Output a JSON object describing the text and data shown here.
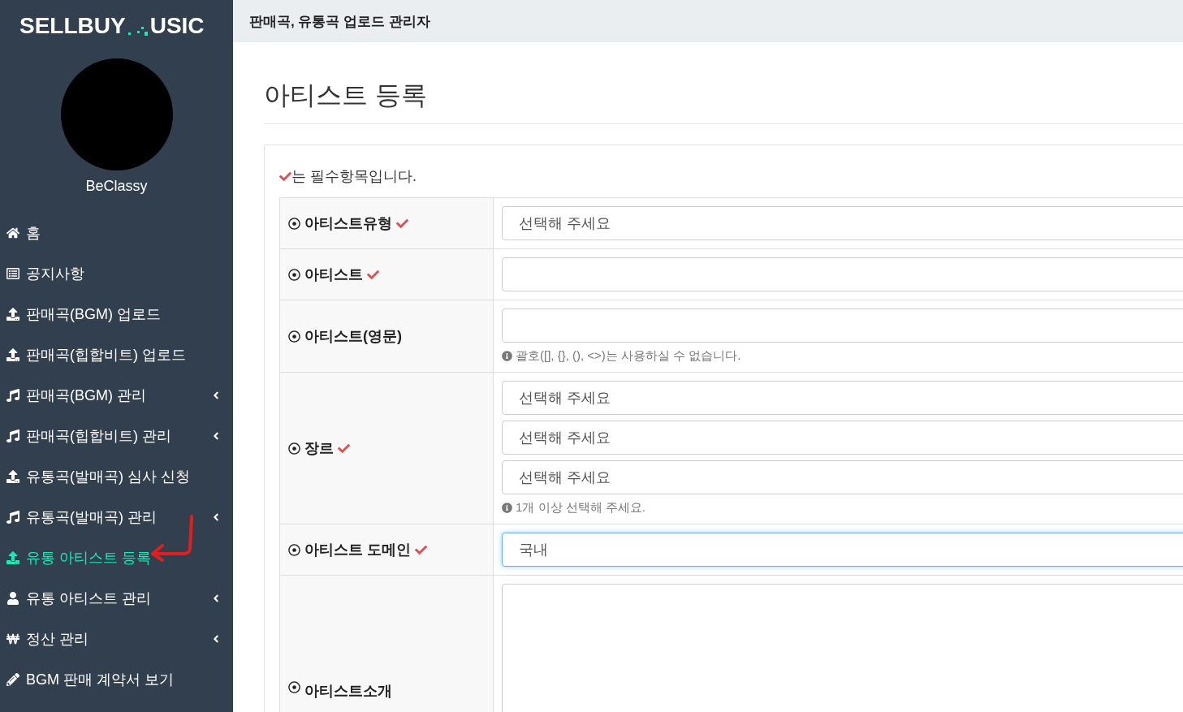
{
  "logo": {
    "left": "SELLBUY",
    "right": "USIC"
  },
  "user": {
    "name": "BeClassy"
  },
  "menu": [
    {
      "label": "홈",
      "submenu": false,
      "selected": false
    },
    {
      "label": "공지사항",
      "submenu": false,
      "selected": false
    },
    {
      "label": "판매곡(BGM) 업로드",
      "submenu": false,
      "selected": false
    },
    {
      "label": "판매곡(힙합비트) 업로드",
      "submenu": false,
      "selected": false
    },
    {
      "label": "판매곡(BGM) 관리",
      "submenu": true,
      "selected": false
    },
    {
      "label": "판매곡(힙합비트) 관리",
      "submenu": true,
      "selected": false
    },
    {
      "label": "유통곡(발매곡) 심사 신청",
      "submenu": false,
      "selected": false
    },
    {
      "label": "유통곡(발매곡) 관리",
      "submenu": true,
      "selected": false
    },
    {
      "label": "유통 아티스트 등록",
      "submenu": false,
      "selected": true
    },
    {
      "label": "유통 아티스트 관리",
      "submenu": true,
      "selected": false
    },
    {
      "label": "정산 관리",
      "submenu": true,
      "selected": false
    },
    {
      "label": "BGM 판매 계약서 보기",
      "submenu": false,
      "selected": false
    }
  ],
  "header": {
    "title": "판매곡, 유통곡 업로드 관리자"
  },
  "page": {
    "title": "아티스트 등록"
  },
  "required_note": "는 필수항목입니다.",
  "form": [
    {
      "label": "아티스트유형",
      "required": true,
      "fields": [
        {
          "kind": "select",
          "value": "선택해 주세요",
          "focused": false
        }
      ]
    },
    {
      "label": "아티스트",
      "required": true,
      "fields": [
        {
          "kind": "input",
          "focused": false
        }
      ]
    },
    {
      "label": "아티스트(영문)",
      "required": false,
      "fields": [
        {
          "kind": "input",
          "focused": false
        }
      ],
      "help": "괄호([], {}, (), <>)는 사용하실 수 없습니다."
    },
    {
      "label": "장르",
      "required": true,
      "fields": [
        {
          "kind": "select",
          "value": "선택해 주세요",
          "focused": false
        },
        {
          "kind": "select",
          "value": "선택해 주세요",
          "focused": false
        },
        {
          "kind": "select",
          "value": "선택해 주세요",
          "focused": false
        }
      ],
      "help": "1개 이상 선택해 주세요."
    },
    {
      "label": "아티스트 도메인",
      "required": true,
      "fields": [
        {
          "kind": "select",
          "value": "국내",
          "focused": true
        }
      ]
    },
    {
      "label": "아티스트소개",
      "required": false,
      "fields": [
        {
          "kind": "textarea",
          "focused": false
        }
      ]
    }
  ]
}
